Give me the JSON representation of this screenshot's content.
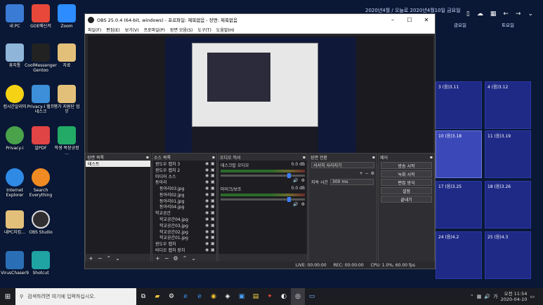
{
  "desktop_icons": [
    {
      "label": "내 PC",
      "icon": "pc-icon",
      "color": "#3a7bd5"
    },
    {
      "label": "GOE메신저",
      "icon": "messenger-icon",
      "color": "#e8483a"
    },
    {
      "label": "Zoom",
      "icon": "zoom-icon",
      "color": "#2d8cff"
    },
    {
      "label": "휴지통",
      "icon": "recycle-bin-icon",
      "color": "#8fb6d8"
    },
    {
      "label": "CoolMessenger Gentoo",
      "icon": "coolmessenger-icon",
      "color": "#222222"
    },
    {
      "label": "자료",
      "icon": "folder-icon",
      "color": "#e3c07a"
    },
    {
      "label": "컴시간알리미",
      "icon": "smiley-icon",
      "color": "#f6d215"
    },
    {
      "label": "Privacy-i 헬프데스크",
      "icon": "privacy-helpdesk-icon",
      "color": "#3c8fd8"
    },
    {
      "label": "평가 지원단 업무",
      "icon": "folder-icon",
      "color": "#e3c07a"
    },
    {
      "label": "Privacy-i",
      "icon": "privacy-icon",
      "color": "#4aa34a"
    },
    {
      "label": "알PDF",
      "icon": "pdf-icon",
      "color": "#e04444"
    },
    {
      "label": "학생 복장규정 …",
      "icon": "chart-doc-icon",
      "color": "#22aa66"
    },
    {
      "label": "Internet Explorer",
      "icon": "ie-icon",
      "color": "#2f8ae6"
    },
    {
      "label": "Search Everything",
      "icon": "search-everything-icon",
      "color": "#f08a22"
    },
    {
      "label": "내PC지킴…",
      "icon": "shield-icon",
      "color": "#e3c07a"
    },
    {
      "label": "OBS Studio",
      "icon": "obs-icon",
      "color": "#302e31"
    },
    {
      "label": "VirusChaser9",
      "icon": "viruschaser-icon",
      "color": "#2a6fb5"
    },
    {
      "label": "Shotcut",
      "icon": "shotcut-icon",
      "color": "#1fa3a3"
    }
  ],
  "calendar": {
    "title": "2020년4월 / 오늘로 2020년4월10일 금요일 (음) 3.18",
    "headers": [
      "금요일",
      "토요일"
    ],
    "cells": [
      {
        "num": "3 (음)3.11"
      },
      {
        "num": "4 (음)3.12"
      },
      {
        "num": "10 (음)3.18"
      },
      {
        "num": "11 (음)3.19"
      },
      {
        "num": "17 (음)3.25"
      },
      {
        "num": "18 (음)3.26"
      },
      {
        "num": "24 (음)4.2"
      },
      {
        "num": "25 (음)4.3"
      }
    ]
  },
  "obs": {
    "title": "OBS 25.0.4 (64-bit, windows) - 프로파일: 제목없음 - 장면: 제목없음",
    "menu": [
      "파일(F)",
      "편집(E)",
      "보기(V)",
      "프로파일(P)",
      "장면 모음(S)",
      "도구(T)",
      "도움말(H)"
    ],
    "scenes": {
      "title": "장면 목록",
      "items": [
        "테스트"
      ]
    },
    "sources": {
      "title": "소스 목록",
      "items": [
        "윈도우 캡처 3",
        "윈도우 캡처 2",
        "미디어 소스",
        "동아리",
        "동아리03.jpg",
        "동아리02.jpg",
        "동아리01.jpg",
        "동아리04.jpg",
        "학교공간",
        "학교공간04.jpg",
        "학교공간03.jpg",
        "학교공간02.jpg",
        "학교공간01.jpg",
        "윈도우 캡처",
        "비디오 캡처 장치"
      ]
    },
    "mixer": {
      "title": "오디오 믹서",
      "channels": [
        {
          "name": "데스크탑 오디오",
          "db": "0.0 dB"
        },
        {
          "name": "마이크/보조",
          "db": "0.0 dB"
        }
      ]
    },
    "transitions": {
      "title": "장면 전환",
      "selected": "서서히 사라지기",
      "duration_label": "지속 시간",
      "duration_value": "300 ms"
    },
    "controls": {
      "title": "제어",
      "buttons": [
        "방송 시작",
        "녹화 시작",
        "편집 방식",
        "설정",
        "끝내기"
      ]
    },
    "status": {
      "live": "LIVE: 00:00:00",
      "rec": "REC: 00:00:00",
      "cpu": "CPU: 1.0%, 60.00 fps"
    }
  },
  "taskbar": {
    "search_placeholder": "검색하려면 여기에 입력하십시오.",
    "time": "오전 11:54",
    "date": "2020-04-10",
    "lang": "가"
  }
}
